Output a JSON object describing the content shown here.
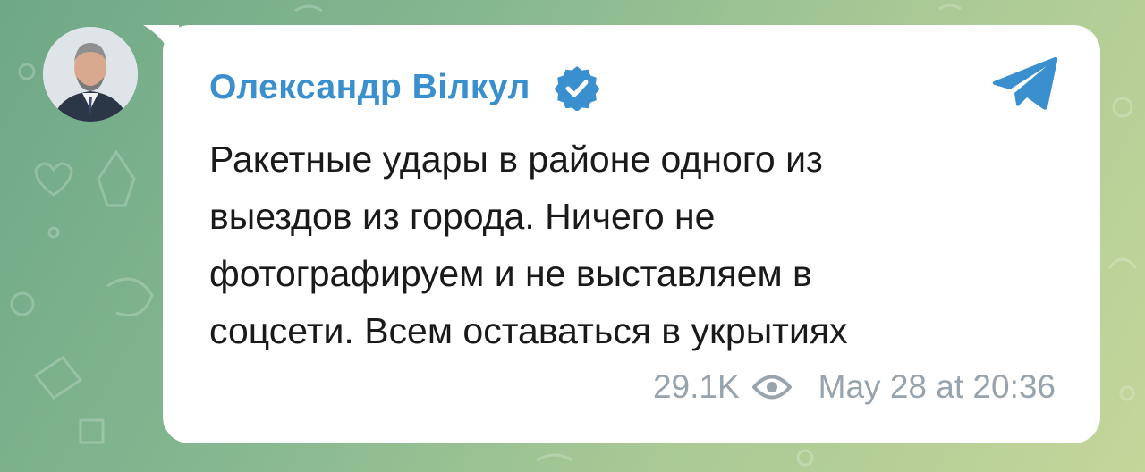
{
  "post": {
    "author": "Олександр Вілкул",
    "verified": true,
    "message": "Ракетные удары в районе одного из\nвыездов из города. Ничего не\nфотографируем и не выставляем в\nсоцсети. Всем оставаться в укрытиях",
    "views": "29.1K",
    "timestamp": "May 28 at 20:36"
  },
  "icons": {
    "verified": "verified-badge-icon",
    "app": "telegram-icon",
    "views": "eye-icon"
  },
  "colors": {
    "author": "#3a8fcf",
    "verified": "#3a8fcf",
    "telegram": "#3a8fcf",
    "meta": "#97a3ad",
    "bubble": "#ffffff",
    "background": "#86b890"
  }
}
